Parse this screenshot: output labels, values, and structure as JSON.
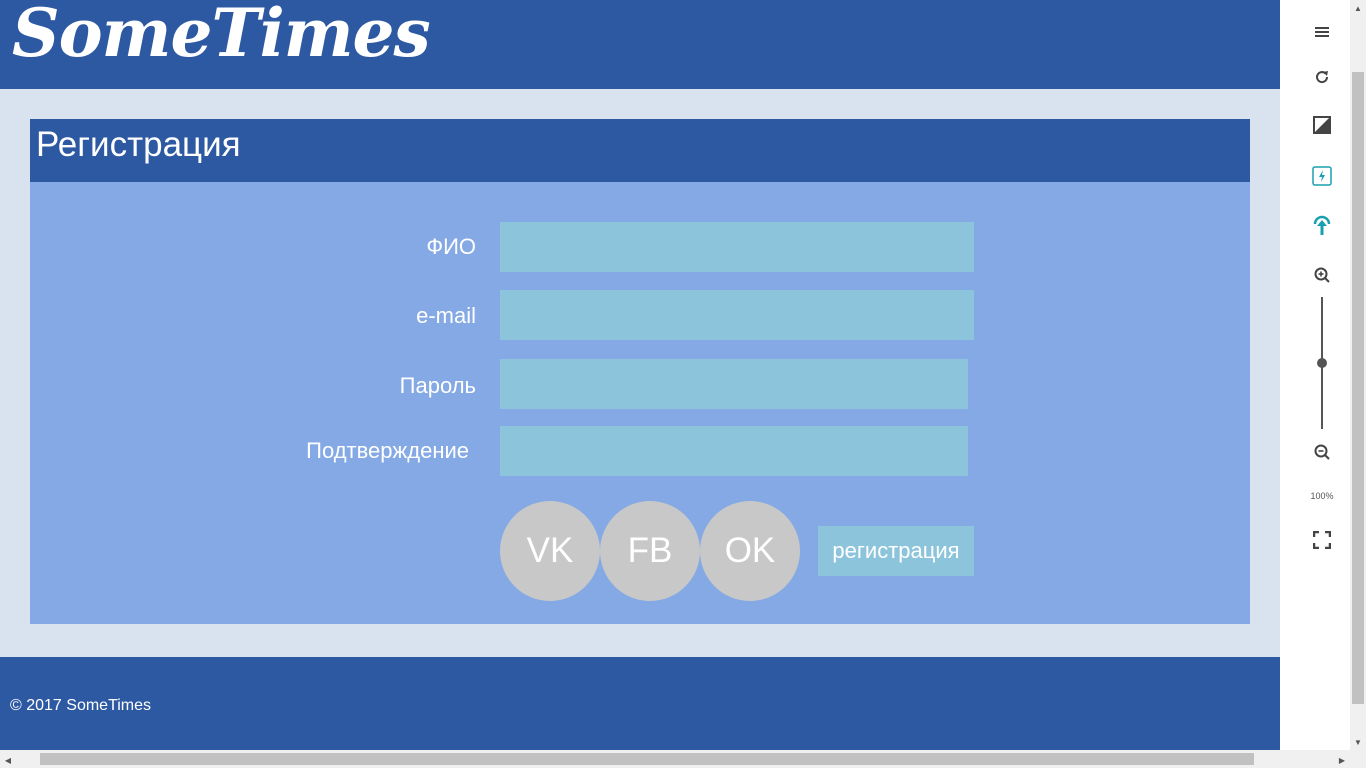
{
  "header": {
    "logo_text": "SomeTimes"
  },
  "form": {
    "title": "Регистрация",
    "fields": [
      {
        "label": "ФИО",
        "value": "",
        "type": "text"
      },
      {
        "label": "e-mail",
        "value": "",
        "type": "email"
      },
      {
        "label": "Пароль",
        "value": "",
        "type": "password"
      },
      {
        "label": "Подтверждение",
        "value": "",
        "type": "password"
      }
    ],
    "social_buttons": [
      "VK",
      "FB",
      "OK"
    ],
    "submit_label": "регистрация"
  },
  "footer": {
    "copyright": "© 2017 SomeTimes"
  },
  "tool_panel": {
    "icons": [
      "menu-icon",
      "refresh-icon",
      "contrast-icon",
      "flash-icon",
      "upload-icon",
      "zoom-in-icon",
      "zoom-out-icon",
      "fullscreen-icon"
    ],
    "zoom_level": "100%",
    "zoom_slider_fraction": 0.5
  },
  "colors": {
    "brand_blue": "#2d59a3",
    "form_bg": "#84a9e4",
    "input_bg": "#8cc5db",
    "page_bg": "#d9e3ef",
    "social_gray": "#c8c8c8"
  }
}
